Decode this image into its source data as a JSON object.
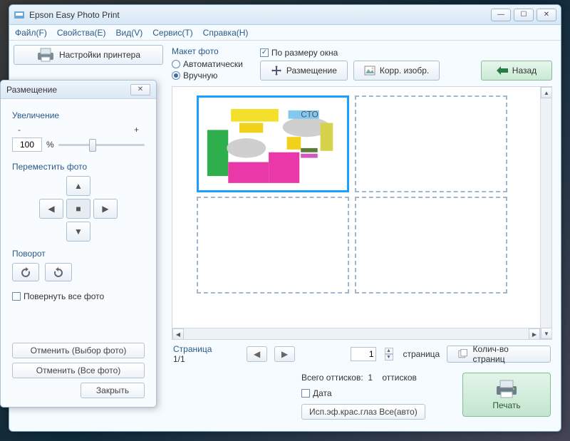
{
  "titlebar": {
    "title": "Epson Easy Photo Print"
  },
  "menu": {
    "file": "Файл(F)",
    "properties": "Свойства(E)",
    "view": "Вид(V)",
    "service": "Сервис(T)",
    "help": "Справка(H)"
  },
  "left": {
    "printer_settings": "Настройки принтера"
  },
  "layout": {
    "group_label": "Макет фото",
    "auto": "Автоматически",
    "manual": "Вручную",
    "fit_label": "По размеру окна",
    "place_btn": "Размещение",
    "correct_btn": "Корр. изобр.",
    "back_btn": "Назад"
  },
  "pager": {
    "group": "Страница",
    "count": "1/1",
    "page_value": "1",
    "page_word": "страница",
    "pages_btn": "Колич-во страниц"
  },
  "footer": {
    "total_label": "Всего оттисков:",
    "total_value": "1",
    "total_word": "оттисков",
    "date_label": "Дата",
    "redeye_btn": "Исп.эф.крас.глаз Все(авто)",
    "print_btn": "Печать"
  },
  "panel": {
    "title": "Размещение",
    "zoom_label": "Увеличение",
    "zoom_value": "100",
    "zoom_unit": "%",
    "move_label": "Переместить фото",
    "rotate_label": "Поворот",
    "rotate_all": "Повернуть все фото",
    "cancel_sel": "Отменить (Выбор фото)",
    "cancel_all": "Отменить (Все фото)",
    "close": "Закрыть"
  }
}
